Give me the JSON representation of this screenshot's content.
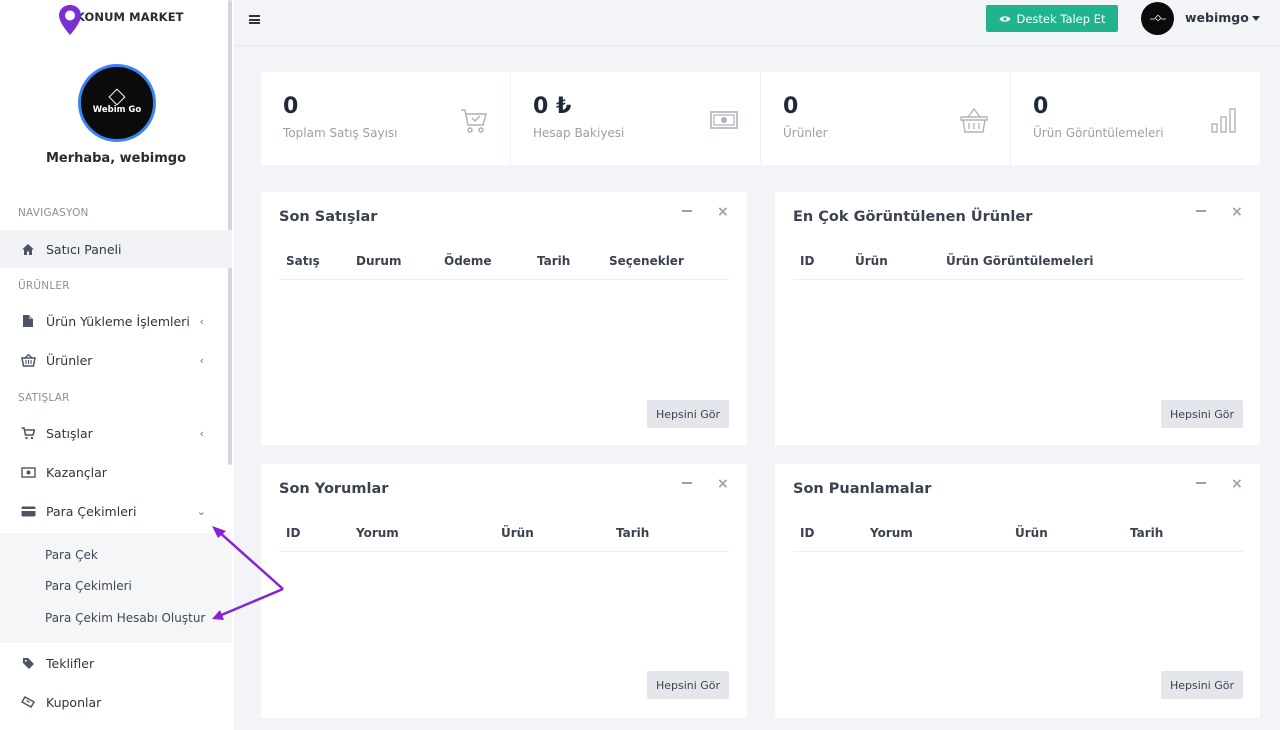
{
  "brand": {
    "name": "KONUM MARKET",
    "avatar_text": "Webim Go"
  },
  "sidebar": {
    "greeting": "Merhaba, webimgo",
    "sections": {
      "nav": "NAVIGASYON",
      "products": "ÜRÜNLER",
      "sales": "SATIŞLAR"
    },
    "items": {
      "dashboard": "Satıcı Paneli",
      "upload": "Ürün Yükleme İşlemleri",
      "products": "Ürünler",
      "sales": "Satışlar",
      "earnings": "Kazançlar",
      "payouts": "Para Çekimleri",
      "offers": "Teklifler",
      "coupons": "Kuponlar"
    },
    "payout_sub": {
      "withdraw": "Para Çek",
      "withdrawals": "Para Çekimleri",
      "create_account": "Para Çekim Hesabı Oluştur"
    }
  },
  "topbar": {
    "support_button": "Destek Talep Et",
    "username": "webimgo"
  },
  "stats": [
    {
      "value": "0",
      "label": "Toplam Satış Sayısı",
      "icon": "cart-icon"
    },
    {
      "value": "0 ₺",
      "label": "Hesap Bakiyesi",
      "icon": "money-icon"
    },
    {
      "value": "0",
      "label": "Ürünler",
      "icon": "basket-icon"
    },
    {
      "value": "0",
      "label": "Ürün Görüntülemeleri",
      "icon": "bar-chart-icon"
    }
  ],
  "cards": {
    "latest_sales": {
      "title": "Son Satışlar",
      "columns": [
        "Satış",
        "Durum",
        "Ödeme",
        "Tarih",
        "Seçenekler"
      ],
      "button": "Hepsini Gör"
    },
    "most_viewed": {
      "title": "En Çok Görüntülenen Ürünler",
      "columns": [
        "ID",
        "Ürün",
        "Ürün Görüntülemeleri"
      ],
      "button": "Hepsini Gör"
    },
    "latest_reviews": {
      "title": "Son Yorumlar",
      "columns": [
        "ID",
        "Yorum",
        "Ürün",
        "Tarih"
      ],
      "button": "Hepsini Gör"
    },
    "latest_ratings": {
      "title": "Son Puanlamalar",
      "columns": [
        "ID",
        "Yorum",
        "Ürün",
        "Tarih"
      ],
      "button": "Hepsini Gör"
    }
  },
  "colors": {
    "accent": "#1fb48e",
    "arrow": "#8a1fd6",
    "logo": "#7b2fd0"
  }
}
